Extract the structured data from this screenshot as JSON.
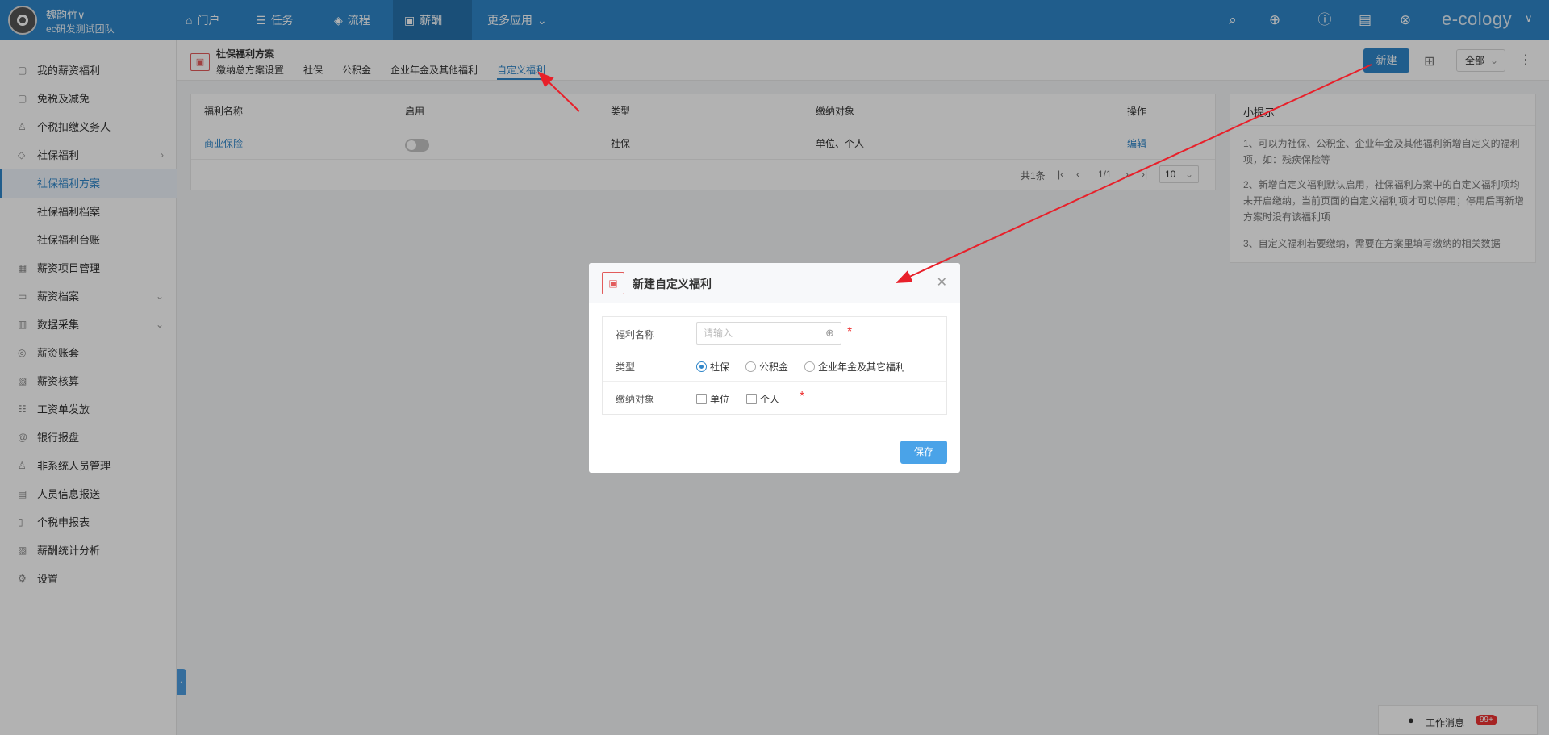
{
  "topbar": {
    "user_name": "魏韵竹∨",
    "user_team": "ec研发测试团队",
    "nav": [
      {
        "label": "门户",
        "icon": "home-icon"
      },
      {
        "label": "任务",
        "icon": "list-icon"
      },
      {
        "label": "流程",
        "icon": "layers-icon"
      },
      {
        "label": "薪酬",
        "icon": "money-icon"
      },
      {
        "label": "更多应用",
        "icon": "chevron-down-icon"
      }
    ],
    "brand": "e-cology",
    "brand_color": "#2f86c9"
  },
  "sidebar": {
    "items": [
      {
        "label": "我的薪资福利"
      },
      {
        "label": "免税及减免"
      },
      {
        "label": "个税扣缴义务人"
      },
      {
        "label": "社保福利"
      },
      {
        "label": "社保福利方案"
      },
      {
        "label": "社保福利档案"
      },
      {
        "label": "社保福利台账"
      },
      {
        "label": "薪资项目管理"
      },
      {
        "label": "薪资档案"
      },
      {
        "label": "数据采集"
      },
      {
        "label": "薪资账套"
      },
      {
        "label": "薪资核算"
      },
      {
        "label": "工资单发放"
      },
      {
        "label": "银行报盘"
      },
      {
        "label": "非系统人员管理"
      },
      {
        "label": "人员信息报送"
      },
      {
        "label": "个税申报表"
      },
      {
        "label": "薪酬统计分析"
      },
      {
        "label": "设置"
      }
    ]
  },
  "page": {
    "title": "社保福利方案",
    "tabs": [
      "缴纳总方案设置",
      "社保",
      "公积金",
      "企业年金及其他福利",
      "自定义福利"
    ],
    "new_button": "新建",
    "filter_value": "全部"
  },
  "table": {
    "headers": [
      "福利名称",
      "启用",
      "类型",
      "缴纳对象",
      "操作"
    ],
    "rows": [
      {
        "name": "商业保险",
        "type": "社保",
        "target": "单位、个人",
        "action": "编辑"
      }
    ],
    "total": "共1条",
    "page": "1/1",
    "page_size": "10"
  },
  "tips": {
    "title": "小提示",
    "items": [
      "1、可以为社保、公积金、企业年金及其他福利新增自定义的福利项，如：残疾保险等",
      "2、新增自定义福利默认启用，社保福利方案中的自定义福利项均未开启缴纳，当前页面的自定义福利项才可以停用；停用后再新增方案时没有该福利项",
      "3、自定义福利若要缴纳，需要在方案里填写缴纳的相关数据"
    ]
  },
  "modal": {
    "title": "新建自定义福利",
    "name_label": "福利名称",
    "name_placeholder": "请输入",
    "type_label": "类型",
    "type_options": [
      "社保",
      "公积金",
      "企业年金及其它福利"
    ],
    "target_label": "缴纳对象",
    "target_options": [
      "单位",
      "个人"
    ],
    "save": "保存"
  },
  "messages": {
    "label": "工作消息",
    "badge": "99+"
  }
}
